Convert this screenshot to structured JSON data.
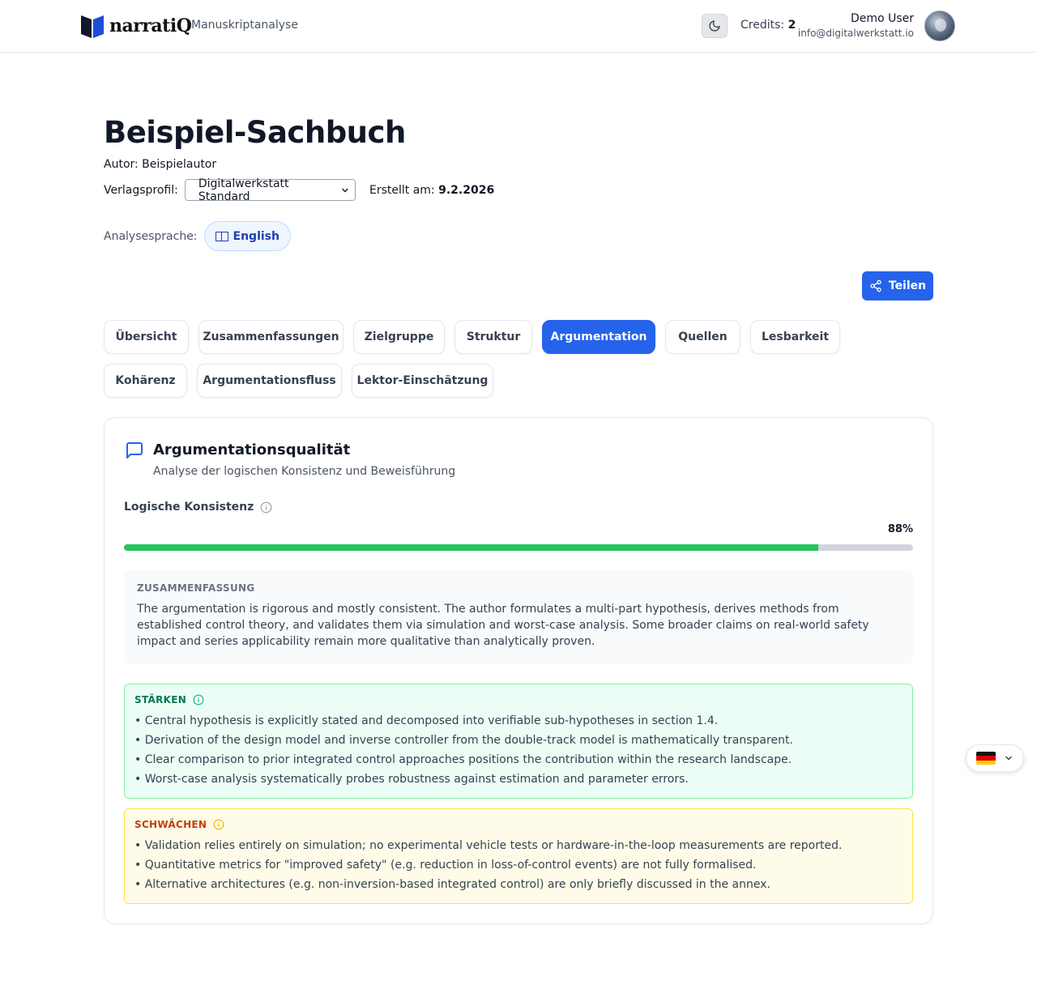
{
  "header": {
    "brand": "narratiQ",
    "subtitle": "Manuskriptanalyse",
    "credits_label": "Credits:",
    "credits_value": "2",
    "user_name": "Demo User",
    "user_email": "info@digitalwerkstatt.io",
    "icons": {
      "logo": "book-icon",
      "theme": "moon-icon"
    }
  },
  "book": {
    "title": "Beispiel-Sachbuch",
    "author_line": "Autor: Beispielautor",
    "profile_label": "Verlagsprofil:",
    "profile_value": "Digitalwerkstatt Standard",
    "created_label": "Erstellt am:",
    "created_value": "9.2.2026",
    "language_label": "Analysesprache:",
    "language_value": "English"
  },
  "actions": {
    "share_label": "Teilen",
    "share_icon": "share-icon"
  },
  "tabs": [
    {
      "label": "Übersicht",
      "active": false
    },
    {
      "label": "Zusammenfassungen",
      "active": false
    },
    {
      "label": "Zielgruppe",
      "active": false
    },
    {
      "label": "Struktur",
      "active": false
    },
    {
      "label": "Argumentation",
      "active": true
    },
    {
      "label": "Quellen",
      "active": false
    },
    {
      "label": "Lesbarkeit",
      "active": false
    },
    {
      "label": "Kohärenz",
      "active": false
    },
    {
      "label": "Argumentationsfluss",
      "active": false
    },
    {
      "label": "Lektor-Einschätzung",
      "active": false
    }
  ],
  "card": {
    "title": "Argumentationsqualität",
    "subtitle": "Analyse der logischen Konsistenz und Beweisführung",
    "icon": "message-square-icon",
    "metric_label": "Logische Konsistenz",
    "metric_value": "88%",
    "metric_fraction": 0.88,
    "summary_heading": "ZUSAMMENFASSUNG",
    "summary_text": "The argumentation is rigorous and mostly consistent. The author formulates a multi-part hypothesis, derives methods from established control theory, and validates them via simulation and worst-case analysis. Some broader claims on real-world safety impact and series applicability remain more qualitative than analytically proven.",
    "strengths_heading": "STÄRKEN",
    "strengths": [
      "Central hypothesis is explicitly stated and decomposed into verifiable sub-hypotheses in section 1.4.",
      "Derivation of the design model and inverse controller from the double-track model is mathematically transparent.",
      "Clear comparison to prior integrated control approaches positions the contribution within the research landscape.",
      "Worst-case analysis systematically probes robustness against estimation and parameter errors."
    ],
    "weaknesses_heading": "SCHWÄCHEN",
    "weaknesses": [
      "Validation relies entirely on simulation; no experimental vehicle tests or hardware-in-the-loop measurements are reported.",
      "Quantitative metrics for \"improved safety\" (e.g. reduction in loss-of-control events) are not fully formalised.",
      "Alternative architectures (e.g. non-inversion-based integrated control) are only briefly discussed in the annex."
    ]
  },
  "language_switcher": {
    "flag": "germany-flag-icon"
  },
  "colors": {
    "primary": "#2563eb",
    "progress": "#22c55e",
    "strengths_bg": "#ecfdf5",
    "weaknesses_bg": "#fefce8"
  }
}
